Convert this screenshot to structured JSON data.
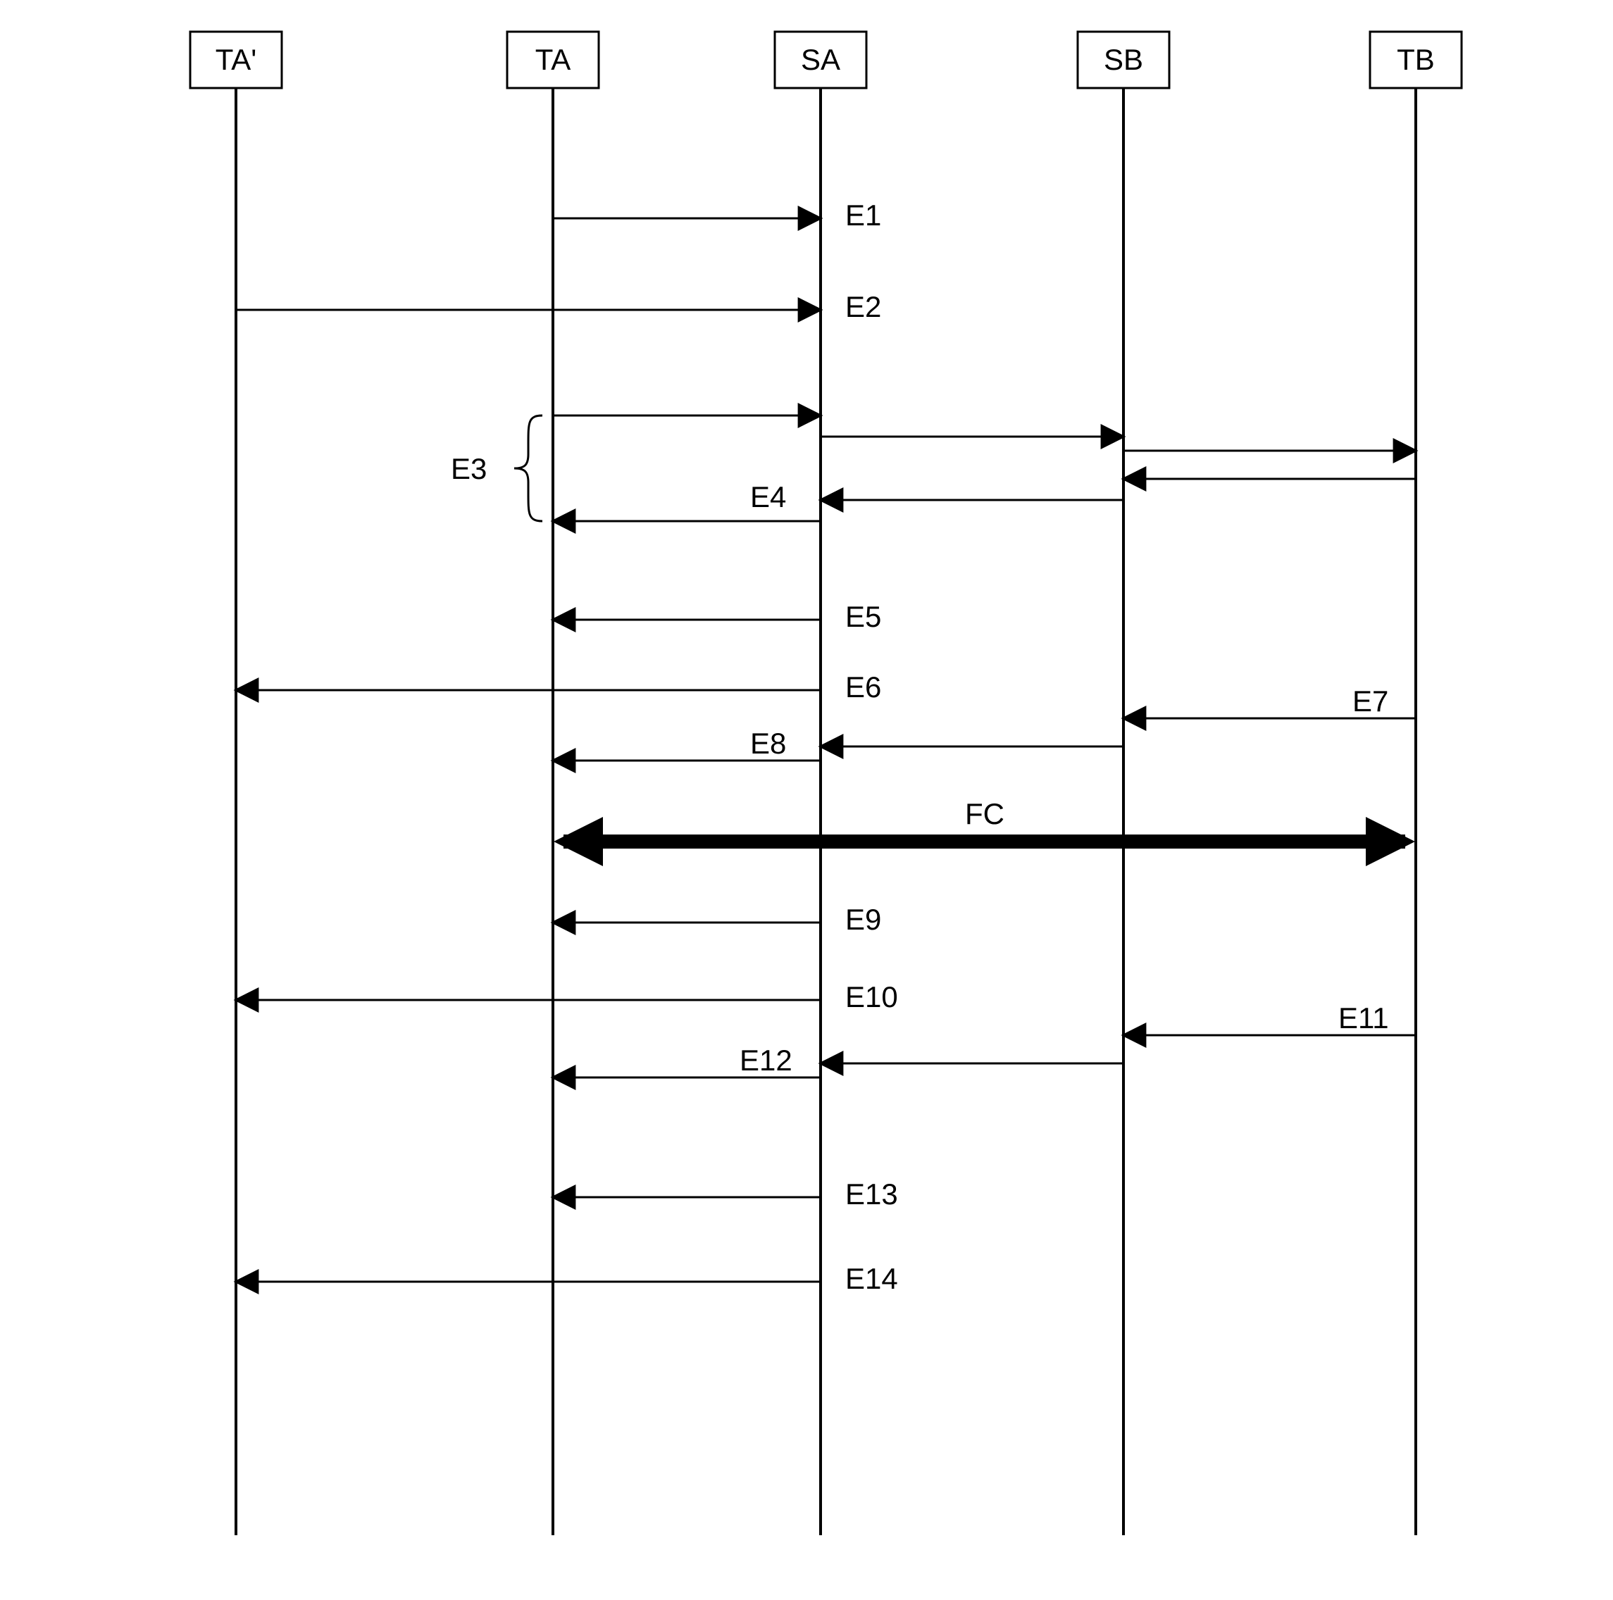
{
  "lifelines": {
    "ta_prime": "TA'",
    "ta": "TA",
    "sa": "SA",
    "sb": "SB",
    "tb": "TB"
  },
  "events": {
    "e1": "E1",
    "e2": "E2",
    "e3": "E3",
    "e4": "E4",
    "e5": "E5",
    "e6": "E6",
    "e7": "E7",
    "e8": "E8",
    "fc": "FC",
    "e9": "E9",
    "e10": "E10",
    "e11": "E11",
    "e12": "E12",
    "e13": "E13",
    "e14": "E14"
  }
}
